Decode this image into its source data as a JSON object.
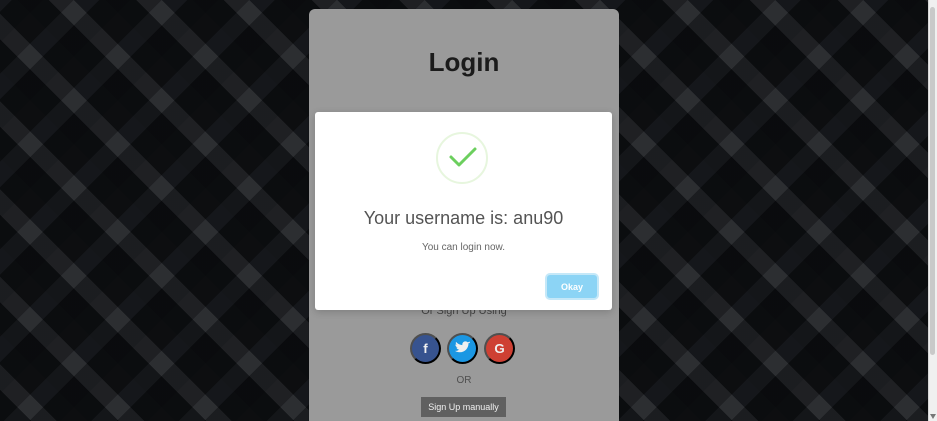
{
  "login": {
    "title": "Login",
    "signup_using": "Or Sign Up Using",
    "social": {
      "facebook": "f",
      "twitter": "t",
      "google": "G"
    },
    "or": "OR",
    "manual_signup": "Sign Up manually"
  },
  "modal": {
    "title": "Your username is: anu90",
    "message": "You can login now.",
    "button": "Okay"
  },
  "colors": {
    "modal_button": "#8cd4f5",
    "success": "#6ccf5e",
    "card": "#a4a4a4"
  },
  "icons": {
    "success": "checkmark-icon",
    "facebook": "facebook-icon",
    "twitter": "twitter-icon",
    "google": "google-icon"
  }
}
